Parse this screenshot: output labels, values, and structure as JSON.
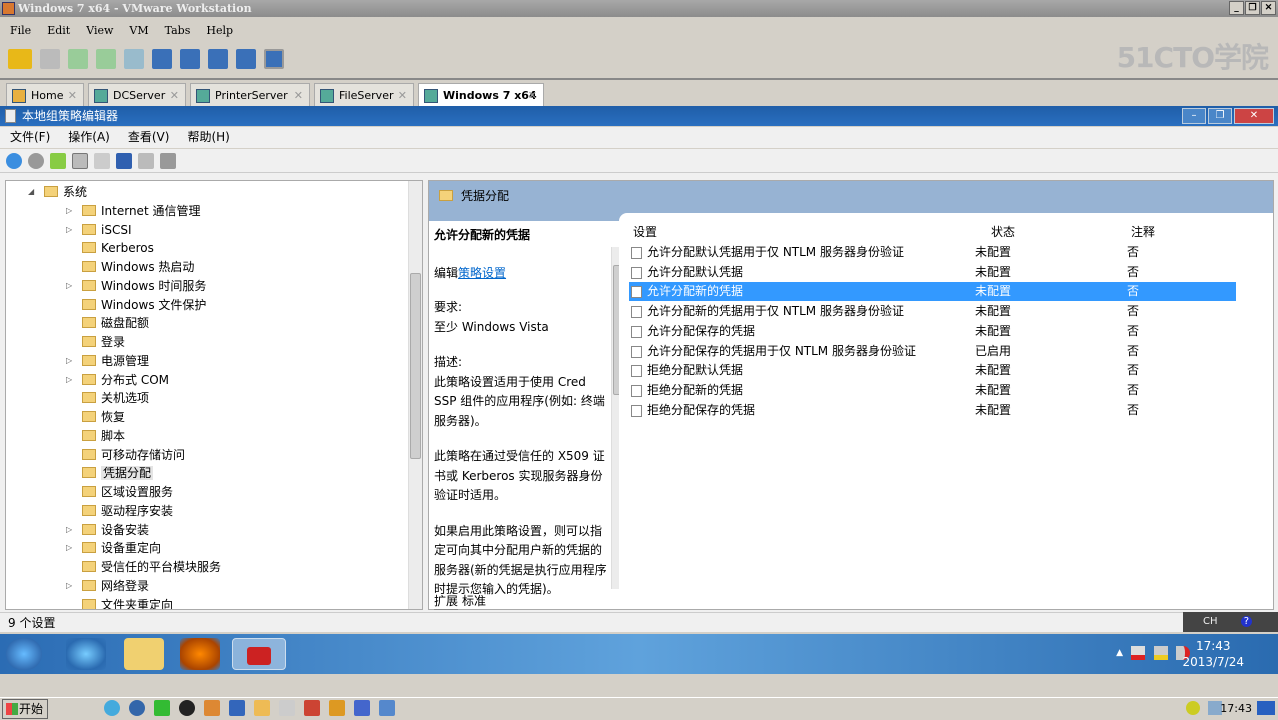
{
  "vmware": {
    "title": "Windows 7 x64 - VMware Workstation",
    "menu": [
      "File",
      "Edit",
      "View",
      "VM",
      "Tabs",
      "Help"
    ],
    "logo": "51CTO学院",
    "tabs": [
      {
        "label": "Home"
      },
      {
        "label": "DCServer"
      },
      {
        "label": "PrinterServer"
      },
      {
        "label": "FileServer"
      },
      {
        "label": "Windows 7 x64",
        "active": true
      }
    ]
  },
  "guest": {
    "title": "本地组策略编辑器",
    "menu": [
      "文件(F)",
      "操作(A)",
      "查看(V)",
      "帮助(H)"
    ],
    "tree": [
      {
        "label": "系统",
        "level": 0,
        "expanded": true
      },
      {
        "label": "Internet 通信管理",
        "arrow": true
      },
      {
        "label": "iSCSI",
        "arrow": true
      },
      {
        "label": "Kerberos"
      },
      {
        "label": "Windows 热启动"
      },
      {
        "label": "Windows 时间服务",
        "arrow": true
      },
      {
        "label": "Windows 文件保护"
      },
      {
        "label": "磁盘配额"
      },
      {
        "label": "登录"
      },
      {
        "label": "电源管理",
        "arrow": true
      },
      {
        "label": "分布式 COM",
        "arrow": true
      },
      {
        "label": "关机选项"
      },
      {
        "label": "恢复"
      },
      {
        "label": "脚本"
      },
      {
        "label": "可移动存储访问"
      },
      {
        "label": "凭据分配",
        "selected": true
      },
      {
        "label": "区域设置服务"
      },
      {
        "label": "驱动程序安装"
      },
      {
        "label": "设备安装",
        "arrow": true
      },
      {
        "label": "设备重定向",
        "arrow": true
      },
      {
        "label": "受信任的平台模块服务"
      },
      {
        "label": "网络登录",
        "arrow": true
      },
      {
        "label": "文件夹重定向"
      }
    ],
    "folder_title": "凭据分配",
    "desc": {
      "title": "允许分配新的凭据",
      "edit_prefix": "编辑",
      "edit_link": "策略设置",
      "req_label": "要求:",
      "req": "至少 Windows Vista",
      "desc_label": "描述:",
      "p1": "此策略设置适用于使用 Cred SSP 组件的应用程序(例如: 终端服务器)。",
      "p2": "此策略在通过受信任的 X509 证书或 Kerberos 实现服务器身份验证时适用。",
      "p3": "如果启用此策略设置，则可以指定可向其中分配用户新的凭据的服务器(新的凭据是执行应用程序时提示您输入的凭据)。"
    },
    "columns": [
      "设置",
      "状态",
      "注释"
    ],
    "rows": [
      [
        "允许分配默认凭据用于仅 NTLM 服务器身份验证",
        "未配置",
        "否"
      ],
      [
        "允许分配默认凭据",
        "未配置",
        "否"
      ],
      [
        "允许分配新的凭据",
        "未配置",
        "否"
      ],
      [
        "允许分配新的凭据用于仅 NTLM 服务器身份验证",
        "未配置",
        "否"
      ],
      [
        "允许分配保存的凭据",
        "未配置",
        "否"
      ],
      [
        "允许分配保存的凭据用于仅 NTLM 服务器身份验证",
        "已启用",
        "否"
      ],
      [
        "拒绝分配默认凭据",
        "未配置",
        "否"
      ],
      [
        "拒绝分配新的凭据",
        "未配置",
        "否"
      ],
      [
        "拒绝分配保存的凭据",
        "未配置",
        "否"
      ]
    ],
    "selected_row": 2,
    "bottom_tabs": [
      "扩展",
      "标准"
    ],
    "status": "9 个设置",
    "lang": "CH",
    "time": "17:43",
    "date": "2013/7/24"
  },
  "host": {
    "start": "开始",
    "time": "17:43"
  }
}
